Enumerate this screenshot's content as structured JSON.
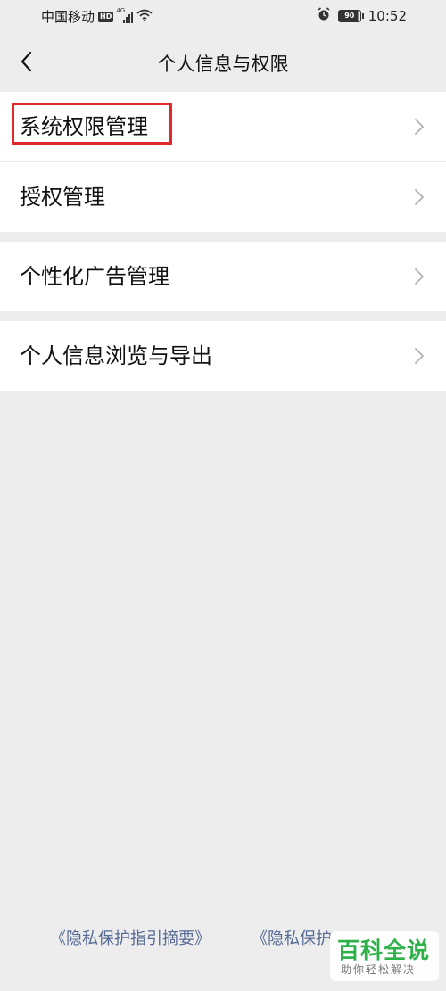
{
  "status_bar": {
    "carrier": "中国移动",
    "hd": "HD",
    "network": "4G",
    "battery": "90",
    "time": "10:52"
  },
  "header": {
    "title": "个人信息与权限",
    "back_icon": "chevron-left-icon"
  },
  "menu": {
    "group1": [
      {
        "label": "系统权限管理",
        "highlighted": true
      },
      {
        "label": "授权管理"
      }
    ],
    "group2": [
      {
        "label": "个性化广告管理"
      }
    ],
    "group3": [
      {
        "label": "个人信息浏览与导出"
      }
    ]
  },
  "footer": {
    "link1": "《隐私保护指引摘要》",
    "link2": "《隐私保护"
  },
  "watermark": {
    "title": "百科全说",
    "subtitle": "助你轻松解决"
  },
  "colors": {
    "highlight": "#e0282b",
    "link": "#576b95",
    "watermark": "#2db24a",
    "background": "#ededed"
  }
}
